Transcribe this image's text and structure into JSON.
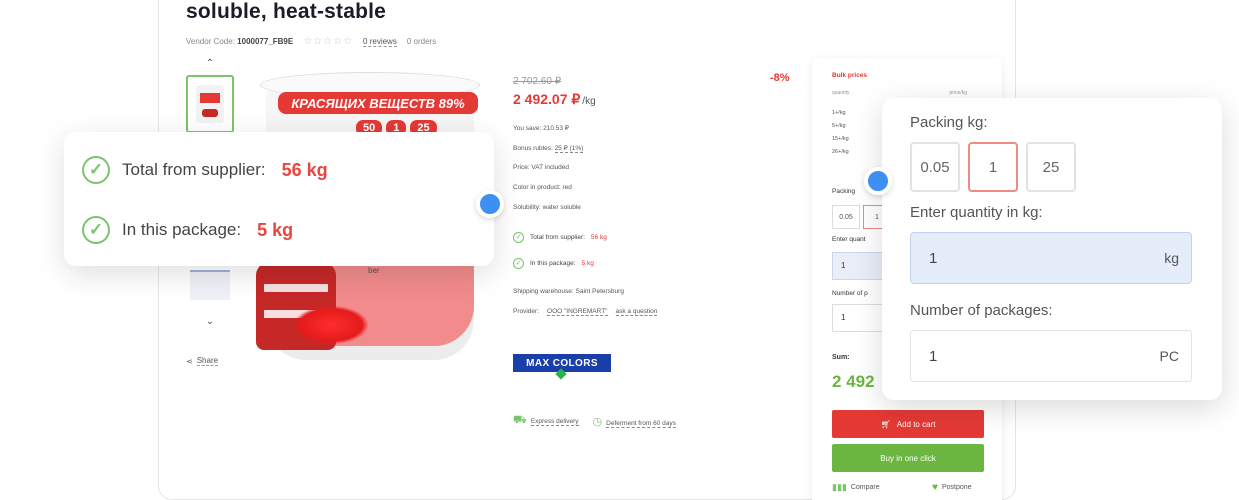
{
  "product": {
    "title": "soluble, heat-stable",
    "vendor_code_label": "Vendor Code:",
    "vendor_code": "1000077_FB9E",
    "stars": "☆☆☆☆☆",
    "reviews": "0 reviews",
    "orders": "0 orders",
    "banner_text": "КРАСЯЩИХ ВЕЩЕСТВ 89%",
    "sizes": [
      "50",
      "1",
      "25"
    ],
    "bucket_label": "ber",
    "share": "Share"
  },
  "pricing": {
    "old_price": "2 702.60 ₽",
    "new_price": "2 492.07 ₽",
    "unit": "/kg",
    "discount": "-8%",
    "you_save": "You save: 210.53 ₽",
    "bonus_label": "Bonus rubles:",
    "bonus_value": "25 ₽ (1%)",
    "price_vat": "Price: VAT included",
    "color": "Color in product: red",
    "solubility": "Solubility: water soluble"
  },
  "stock": {
    "total_label": "Total from supplier:",
    "total_value": "56 kg",
    "package_label": "In this package:",
    "package_value": "5 kg"
  },
  "shipping": {
    "warehouse": "Shipping warehouse: Saint Petersburg",
    "provider_label": "Provider:",
    "provider_name": "OOO \"INGREMART\"",
    "ask": "ask a question",
    "brand": "MAX COLORS",
    "express": "Express delivery",
    "deferment": "Deferment from 60 days"
  },
  "side": {
    "bulk_title": "Bulk prices",
    "col_quantity": "quantity",
    "col_price": "price/kg",
    "bulk_rows": [
      "1+/kg",
      "5+/kg",
      "15+/kg",
      "26+/kg"
    ],
    "packing_label": "Packing",
    "enter_label": "Enter quant",
    "number_label": "Number of p",
    "small_qty": "1",
    "small_num": "1",
    "sum_label": "Sum:",
    "sum_value": "2 492",
    "add_to_cart": "Add to cart",
    "buy_one_click": "Buy in one click",
    "compare": "Compare",
    "postpone": "Postpone"
  },
  "order_popup": {
    "packing_label": "Packing kg:",
    "packing_options": [
      "0.05",
      "1",
      "25"
    ],
    "selected_option": "1",
    "quantity_label": "Enter quantity in kg:",
    "quantity_value": "1",
    "quantity_unit": "kg",
    "packages_label": "Number of packages:",
    "packages_value": "1",
    "packages_unit": "PC"
  },
  "colors": {
    "accent_red": "#e53935",
    "accent_green": "#6bb641",
    "dot_blue": "#3d8ff2"
  }
}
